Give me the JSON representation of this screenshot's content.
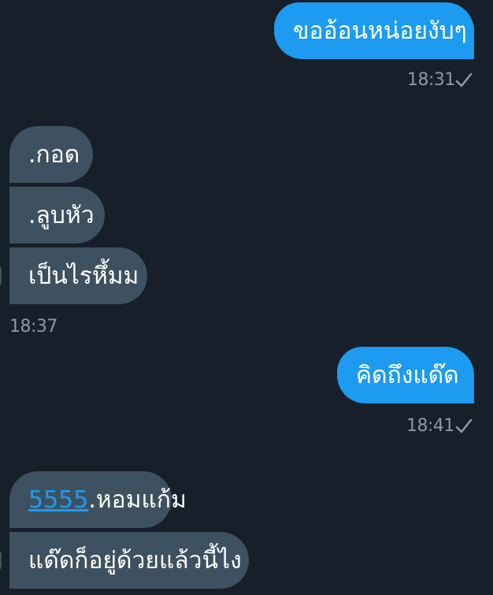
{
  "messages": [
    {
      "text": "ขออ้อนหน่อยงับๆ",
      "time": "18:31",
      "direction": "outgoing",
      "status_icon": "check-icon"
    },
    {
      "text": ".กอด",
      "direction": "incoming"
    },
    {
      "text": ".ลูบหัว",
      "direction": "incoming"
    },
    {
      "text": "เป็นไรหึ้มม",
      "direction": "incoming"
    },
    {
      "time": "18:37"
    },
    {
      "text": "คิดถึงแด๊ด",
      "time": "18:41",
      "direction": "outgoing",
      "status_icon": "check-icon"
    },
    {
      "link": "5555",
      "text": ".หอมแก้ม",
      "direction": "incoming"
    },
    {
      "text": "แด๊ดก็อยู่ด้วยแล้วนี้ไง",
      "direction": "incoming"
    }
  ],
  "colors": {
    "background": "#17202a",
    "outgoing_bubble": "#1d9bf0",
    "incoming_bubble": "#3e5160",
    "timestamp": "#8b98a5",
    "link": "#1d9bf0"
  }
}
